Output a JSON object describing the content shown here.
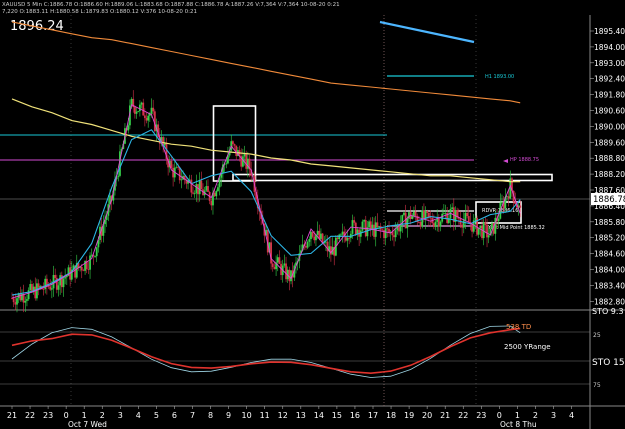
{
  "header": {
    "info": "XAUUSD 5 Min  C:1886.78  O:1886.60  H:1889.06  L:1883.68  O:1887.88  C:1886.78  A:1887.26  V:7,364  V:7,364 10-08-20 0:21",
    "info2": "7,220  O:1883.11  H:1880.58  L:1879.83  O:1880.12  V:376  10-08-20 0:21",
    "last_price_label": "1896.24"
  },
  "price_axis": {
    "ticks": [
      "1895.40",
      "1894.00",
      "1893.00",
      "1892.40",
      "1891.80",
      "1890.60",
      "1890.00",
      "1889.60",
      "1888.80",
      "1888.20",
      "1887.60",
      "1886.40",
      "1885.80",
      "1885.20",
      "1884.60",
      "1884.00",
      "1883.40",
      "1882.80"
    ],
    "current_price": "1886.78",
    "range": [
      1882.2,
      1896.7
    ]
  },
  "time_axis": {
    "labels": [
      "21",
      "22",
      "23",
      "0",
      "1",
      "2",
      "3",
      "4",
      "5",
      "6",
      "7",
      "8",
      "9",
      "10",
      "11",
      "12",
      "13",
      "14",
      "15",
      "16",
      "17",
      "18",
      "19",
      "20",
      "21",
      "22",
      "23",
      "0",
      "1",
      "2",
      "3",
      "4"
    ],
    "date_labels": [
      "Oct 7 Wed",
      "Oct 8 Thu"
    ]
  },
  "annotations": {
    "h1": "H1 1893.00",
    "hp": "HP 1888.75",
    "rdvr": "RDVR 1886.16",
    "mid": "Yest Mid Point 1885.32"
  },
  "oscillator": {
    "label_td": "538 TD",
    "label_yrange": "2500 YRange",
    "top_label": "STO 9.3",
    "right_label": "STO 15.",
    "ticks": [
      "25",
      "75"
    ]
  },
  "chart_data": {
    "type": "line",
    "title": "",
    "ylabel": "",
    "ylim": [
      1882.2,
      1896.7
    ],
    "x_hours": [
      -3,
      -2,
      -1,
      0,
      1,
      2,
      3,
      4,
      5,
      6,
      7,
      8,
      9,
      10,
      11,
      12,
      13,
      14,
      15,
      16,
      17,
      18,
      19,
      20,
      21,
      22,
      22.5
    ],
    "series": [
      {
        "values": [
          1882.5,
          1882.8,
          1883.2,
          1883.8,
          1884.5,
          1887.5,
          1892.3,
          1891.8,
          1889.0,
          1888.3,
          1887.6,
          1890.2,
          1889.0,
          1884.5,
          1883.5,
          1886.0,
          1884.8,
          1886.1,
          1886.0,
          1885.8,
          1886.7,
          1886.4,
          1886.8,
          1886.3,
          1885.7,
          1888.2,
          1886.8
        ]
      },
      {
        "values": [
          1892.6,
          1892.2,
          1891.9,
          1891.5,
          1891.3,
          1891.0,
          1890.7,
          1890.5,
          1890.3,
          1890.2,
          1890.0,
          1889.9,
          1889.8,
          1889.6,
          1889.5,
          1889.3,
          1889.2,
          1889.1,
          1889.0,
          1888.9,
          1888.8,
          1888.7,
          1888.7,
          1888.6,
          1888.5,
          1888.4,
          1888.4
        ]
      },
      {
        "values": [
          1896.5,
          1896.3,
          1896.1,
          1895.9,
          1895.7,
          1895.6,
          1895.4,
          1895.2,
          1895.0,
          1894.8,
          1894.6,
          1894.4,
          1894.2,
          1894.0,
          1893.8,
          1893.6,
          1893.4,
          1893.3,
          1893.2,
          1893.1,
          1893.0,
          1892.9,
          1892.8,
          1892.7,
          1892.6,
          1892.5,
          1892.4
        ]
      }
    ]
  }
}
